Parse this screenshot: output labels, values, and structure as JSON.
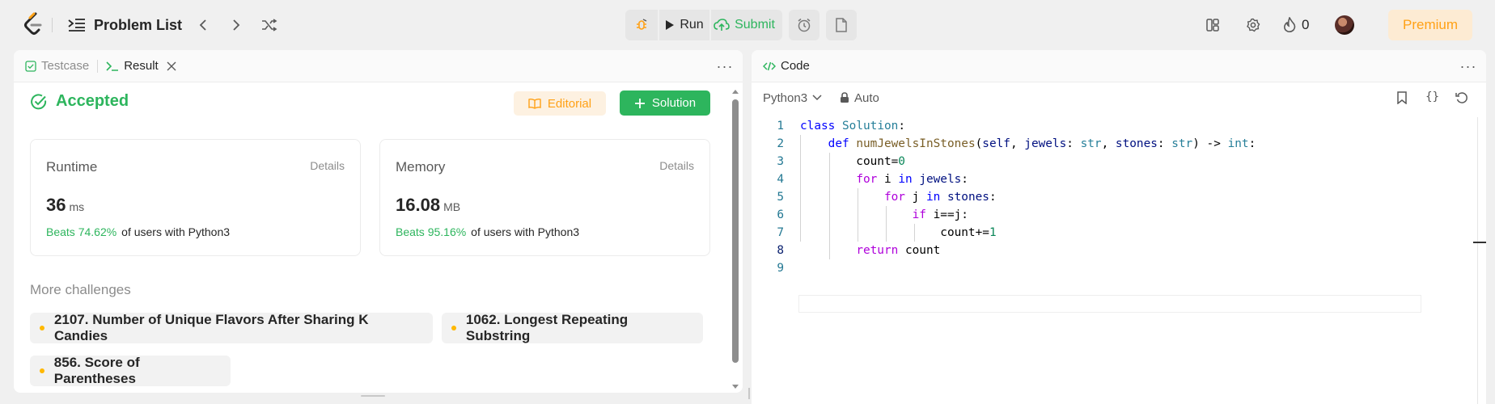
{
  "topbar": {
    "title": "Problem List",
    "run_label": "Run",
    "submit_label": "Submit",
    "streak_count": "0",
    "premium_label": "Premium"
  },
  "left_panel": {
    "tabs": [
      {
        "label": "Testcase"
      },
      {
        "label": "Result"
      }
    ],
    "status": "Accepted",
    "editorial_label": "Editorial",
    "solution_label": "Solution",
    "runtime": {
      "label": "Runtime",
      "details": "Details",
      "value": "36",
      "unit": "ms",
      "beats": "Beats 74.62%",
      "beats_suffix": "of users with Python3"
    },
    "memory": {
      "label": "Memory",
      "details": "Details",
      "value": "16.08",
      "unit": "MB",
      "beats": "Beats 95.16%",
      "beats_suffix": "of users with Python3"
    },
    "more_challenges_title": "More challenges",
    "challenges": [
      "2107. Number of Unique Flavors After Sharing K Candies",
      "1062. Longest Repeating Substring",
      "856. Score of Parentheses"
    ]
  },
  "right_panel": {
    "tab_label": "Code",
    "language": "Python3",
    "mode": "Auto",
    "line_numbers": [
      "1",
      "2",
      "3",
      "4",
      "5",
      "6",
      "7",
      "8",
      "9"
    ],
    "code_lines": [
      "class Solution:",
      "    def numJewelsInStones(self, jewels: str, stones: str) -> int:",
      "        count=0",
      "        for i in jewels:",
      "            for j in stones:",
      "                if i==j:",
      "                    count+=1",
      "        return count",
      ""
    ]
  },
  "colors": {
    "accent_green": "#2db55d",
    "accent_orange": "#ffa116",
    "premium_bg": "#fdebd3"
  },
  "icons": [
    "leetcode-logo",
    "problem-list-icon",
    "chevron-left-icon",
    "chevron-right-icon",
    "shuffle-icon",
    "debug-icon",
    "play-icon",
    "cloud-upload-icon",
    "alarm-icon",
    "note-icon",
    "layout-icon",
    "gear-icon",
    "fire-icon",
    "avatar",
    "checkbox-icon",
    "terminal-icon",
    "close-icon",
    "more-icon",
    "check-circle-icon",
    "book-icon",
    "plus-icon",
    "code-icon",
    "lock-icon",
    "bookmark-icon",
    "braces-icon",
    "reset-icon"
  ]
}
